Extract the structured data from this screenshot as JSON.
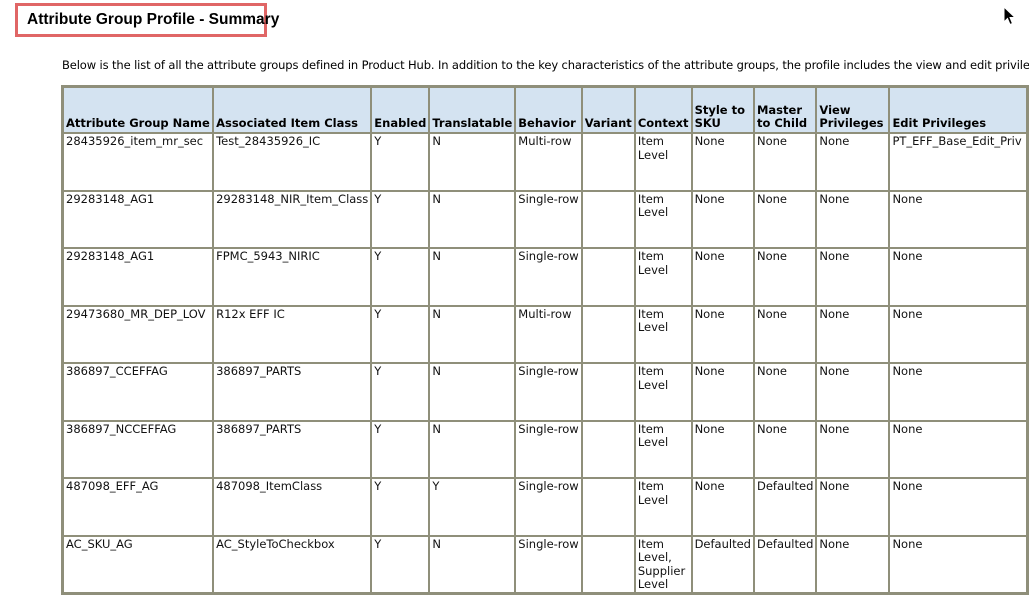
{
  "page": {
    "title": "Attribute Group Profile - Summary",
    "intro": "Below is the list of all the attribute groups defined in Product Hub. In addition to the key characteristics of the attribute groups, the profile includes the view and edit privileges associated with them."
  },
  "table": {
    "headers": {
      "name": "Attribute Group Name",
      "item_class": "Associated Item Class",
      "enabled": "Enabled",
      "translatable": "Translatable",
      "behavior": "Behavior",
      "variant": "Variant",
      "context": "Context",
      "style_to_sku": "Style to SKU",
      "master_to_child": "Master to Child",
      "view_privileges": "View Privileges",
      "edit_privileges": "Edit Privileges"
    },
    "rows": [
      {
        "name": "28435926_item_mr_sec",
        "item_class": "Test_28435926_IC",
        "enabled": "Y",
        "translatable": "N",
        "behavior": "Multi-row",
        "variant": "",
        "context": "Item Level",
        "style_to_sku": "None",
        "master_to_child": "None",
        "view_privileges": "None",
        "edit_privileges": "PT_EFF_Base_Edit_Priv"
      },
      {
        "name": "29283148_AG1",
        "item_class": "29283148_NIR_Item_Class",
        "enabled": "Y",
        "translatable": "N",
        "behavior": "Single-row",
        "variant": "",
        "context": "Item Level",
        "style_to_sku": "None",
        "master_to_child": "None",
        "view_privileges": "None",
        "edit_privileges": "None"
      },
      {
        "name": "29283148_AG1",
        "item_class": "FPMC_5943_NIRIC",
        "enabled": "Y",
        "translatable": "N",
        "behavior": "Single-row",
        "variant": "",
        "context": "Item Level",
        "style_to_sku": "None",
        "master_to_child": "None",
        "view_privileges": "None",
        "edit_privileges": "None"
      },
      {
        "name": "29473680_MR_DEP_LOV",
        "item_class": "R12x EFF IC",
        "enabled": "Y",
        "translatable": "N",
        "behavior": "Multi-row",
        "variant": "",
        "context": "Item Level",
        "style_to_sku": "None",
        "master_to_child": "None",
        "view_privileges": "None",
        "edit_privileges": "None"
      },
      {
        "name": "386897_CCEFFAG",
        "item_class": "386897_PARTS",
        "enabled": "Y",
        "translatable": "N",
        "behavior": "Single-row",
        "variant": "",
        "context": "Item Level",
        "style_to_sku": "None",
        "master_to_child": "None",
        "view_privileges": "None",
        "edit_privileges": "None"
      },
      {
        "name": "386897_NCCEFFAG",
        "item_class": "386897_PARTS",
        "enabled": "Y",
        "translatable": "N",
        "behavior": "Single-row",
        "variant": "",
        "context": "Item Level",
        "style_to_sku": "None",
        "master_to_child": "None",
        "view_privileges": "None",
        "edit_privileges": "None"
      },
      {
        "name": "487098_EFF_AG",
        "item_class": "487098_ItemClass",
        "enabled": "Y",
        "translatable": "Y",
        "behavior": "Single-row",
        "variant": "",
        "context": "Item Level",
        "style_to_sku": "None",
        "master_to_child": "Defaulted",
        "view_privileges": "None",
        "edit_privileges": "None"
      },
      {
        "name": "AC_SKU_AG",
        "item_class": "AC_StyleToCheckbox",
        "enabled": "Y",
        "translatable": "N",
        "behavior": "Single-row",
        "variant": "",
        "context": "Item Level, Supplier Level",
        "style_to_sku": "Defaulted",
        "master_to_child": "Defaulted",
        "view_privileges": "None",
        "edit_privileges": "None"
      }
    ]
  },
  "icons": {
    "cursor": "mouse-pointer-icon"
  }
}
